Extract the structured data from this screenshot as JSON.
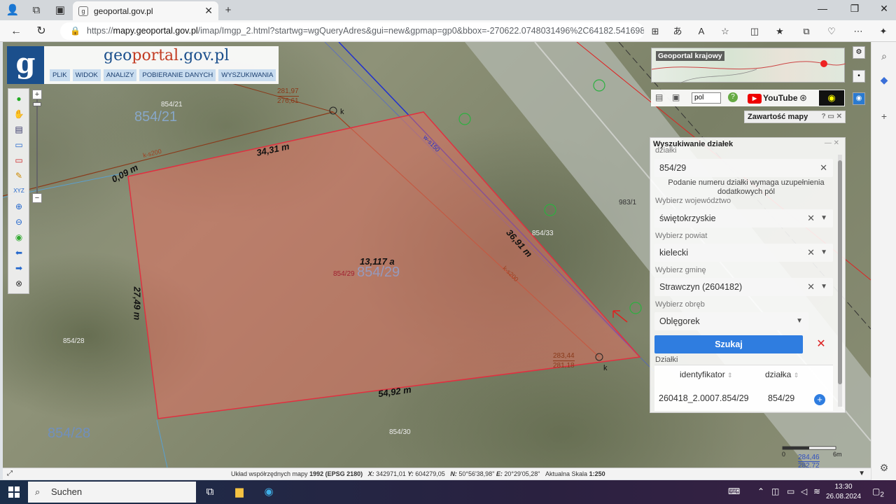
{
  "browser": {
    "tab_title": "geoportal.gov.pl",
    "url_prefix": "https://",
    "url_host": "mapy.geoportal.gov.pl",
    "url_rest": "/imap/Imgp_2.html?startwg=wgQueryAdres&gui=new&gpmap=gp0&bbox=-270622.0748031496%2C64182.5416984166..."
  },
  "app": {
    "brand_a": "g",
    "brand_b": "eo",
    "brand_c": "portal",
    "brand_d": ".gov.pl",
    "logo_letter": "g",
    "menu": [
      "PLIK",
      "WIDOK",
      "ANALIZY",
      "POBIERANIE DANYCH",
      "WYSZUKIWANIA"
    ]
  },
  "map_labels": {
    "parcel_area": "13,117 a",
    "edge_top": "34,31 m",
    "edge_right": "36,91 m",
    "edge_left": "27,49 m",
    "edge_bottom": "54,92 m",
    "edge_small": "0,09 m",
    "parcel_center": "854/29",
    "parcel_center_big": "854/29",
    "parcel_21": "854/21",
    "parcel_21_big": "854/21",
    "parcel_28": "854/28",
    "parcel_28_big": "854/28",
    "parcel_30": "854/30",
    "parcel_33": "854/33",
    "parcel_983": "983/1",
    "elev_1a": "281,97",
    "elev_1b": "276,61",
    "elev_2a": "283,44",
    "elev_2b": "281,18",
    "elev_3a": "284,46",
    "elev_3b": "282,72",
    "k1": "k",
    "k2": "k",
    "ks_1": "k-s200",
    "ks_2": "k-s200",
    "ws_1": "w-s150",
    "scale_zero": "0",
    "scale_max": "6m"
  },
  "overview": {
    "title": "Geoportal krajowy"
  },
  "toolrow": {
    "lang": "pol",
    "youtube": "YouTube"
  },
  "content_bar": {
    "title": "Zawartość mapy"
  },
  "panel": {
    "title": "Wyszukiwanie działek",
    "top_label": "działki",
    "parcel_value": "854/29",
    "hint": "Podanie numeru działki wymaga uzupełnienia dodatkowych pól",
    "woj_label": "Wybierz województwo",
    "woj_value": "świętokrzyskie",
    "pow_label": "Wybierz powiat",
    "pow_value": "kielecki",
    "gmina_label": "Wybierz gminę",
    "gmina_value": "Strawczyn (2604182)",
    "obreb_label": "Wybierz obręb",
    "obreb_value": "Oblęgorek",
    "search_btn": "Szukaj",
    "results_label": "Działki",
    "col_id": "identyfikator",
    "col_parcel": "działka",
    "row_id": "260418_2.0007.854/29",
    "row_parcel": "854/29"
  },
  "status": {
    "system_label": "Układ współrzędnych mapy",
    "system_value": "1992 (EPSG 2180)",
    "x_label": "X:",
    "x_value": "342971,01",
    "y_label": "Y:",
    "y_value": "604279,05",
    "n_label": "N:",
    "n_value": "50°56'38,98\"",
    "e_label": "E:",
    "e_value": "20°29'05,28\"",
    "scale_label": "Aktualna Skala",
    "scale_value": "1:250"
  },
  "taskbar": {
    "search": "Suchen",
    "time": "13:30",
    "date": "26.08.2024",
    "notif_count": "2"
  },
  "colors": {
    "parcel_fill": "#e07060",
    "parcel_stroke": "#e03040",
    "accent": "#2f7de0",
    "brand": "#1b4f8c"
  }
}
